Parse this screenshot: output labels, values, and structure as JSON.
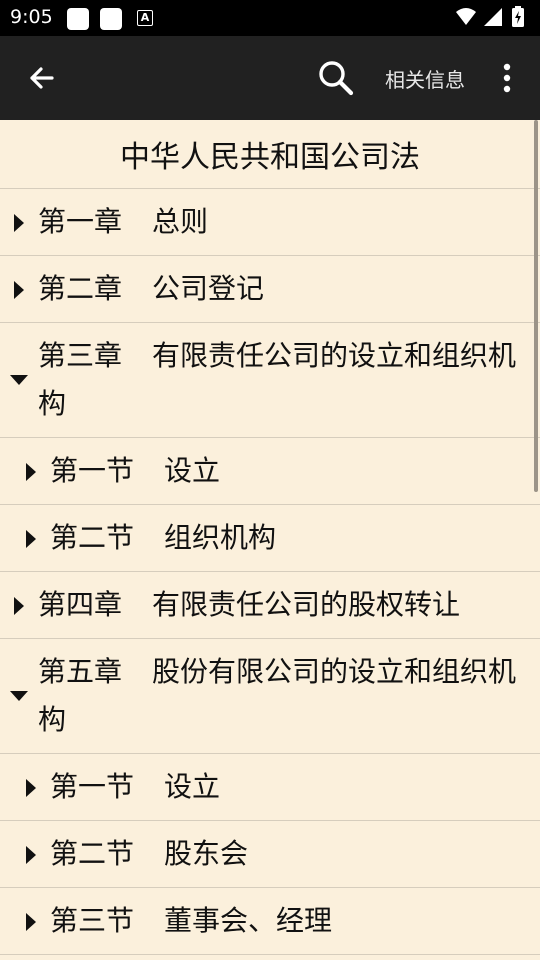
{
  "status_bar": {
    "time": "9:05",
    "notif_letter": "A"
  },
  "app_bar": {
    "related_label": "相关信息"
  },
  "document": {
    "title": "中华人民共和国公司法"
  },
  "toc": [
    {
      "num": "第一章",
      "title": "总则",
      "level": 0,
      "expanded": false
    },
    {
      "num": "第二章",
      "title": "公司登记",
      "level": 0,
      "expanded": false
    },
    {
      "num": "第三章",
      "title": "有限责任公司的设立和组织机构",
      "level": 0,
      "expanded": true
    },
    {
      "num": "第一节",
      "title": "设立",
      "level": 1,
      "expanded": false
    },
    {
      "num": "第二节",
      "title": "组织机构",
      "level": 1,
      "expanded": false
    },
    {
      "num": "第四章",
      "title": "有限责任公司的股权转让",
      "level": 0,
      "expanded": false
    },
    {
      "num": "第五章",
      "title": "股份有限公司的设立和组织机构",
      "level": 0,
      "expanded": true
    },
    {
      "num": "第一节",
      "title": "设立",
      "level": 1,
      "expanded": false
    },
    {
      "num": "第二节",
      "title": "股东会",
      "level": 1,
      "expanded": false
    },
    {
      "num": "第三节",
      "title": "董事会、经理",
      "level": 1,
      "expanded": false
    }
  ],
  "colors": {
    "background": "#fbf0dc",
    "app_bar": "#212121",
    "status_bar": "#000000",
    "divider": "#d6cdbd"
  }
}
